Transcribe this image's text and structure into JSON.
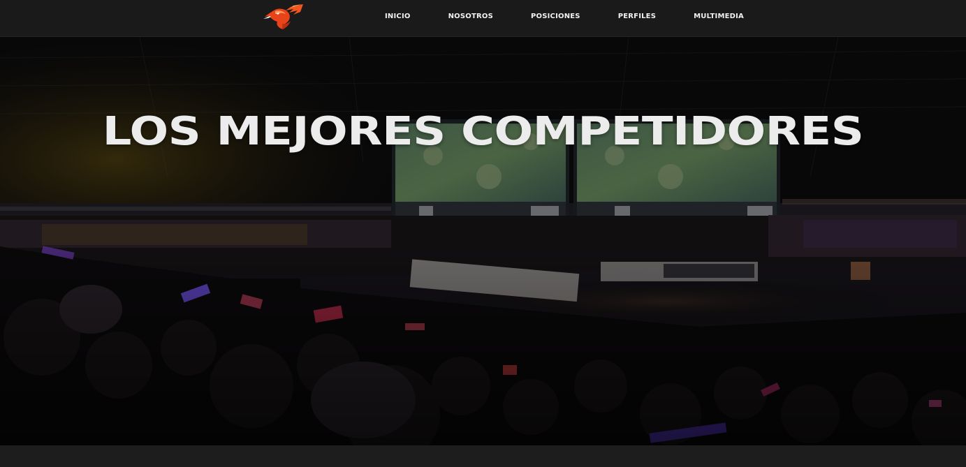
{
  "navbar": {
    "logo_icon": "phoenix-bird-logo-icon",
    "items": [
      {
        "label": "INICIO"
      },
      {
        "label": "NOSOTROS"
      },
      {
        "label": "POSICIONES"
      },
      {
        "label": "PERFILES"
      },
      {
        "label": "MULTIMEDIA"
      }
    ]
  },
  "hero": {
    "title": "LOS MEJORES COMPETIDORES",
    "background_image": "esports-arena-photo"
  },
  "colors": {
    "navbar_bg": "#1a1a1a",
    "page_bg": "#1b1b1b",
    "logo_orange": "#f0561e",
    "title_text": "#ececec"
  }
}
